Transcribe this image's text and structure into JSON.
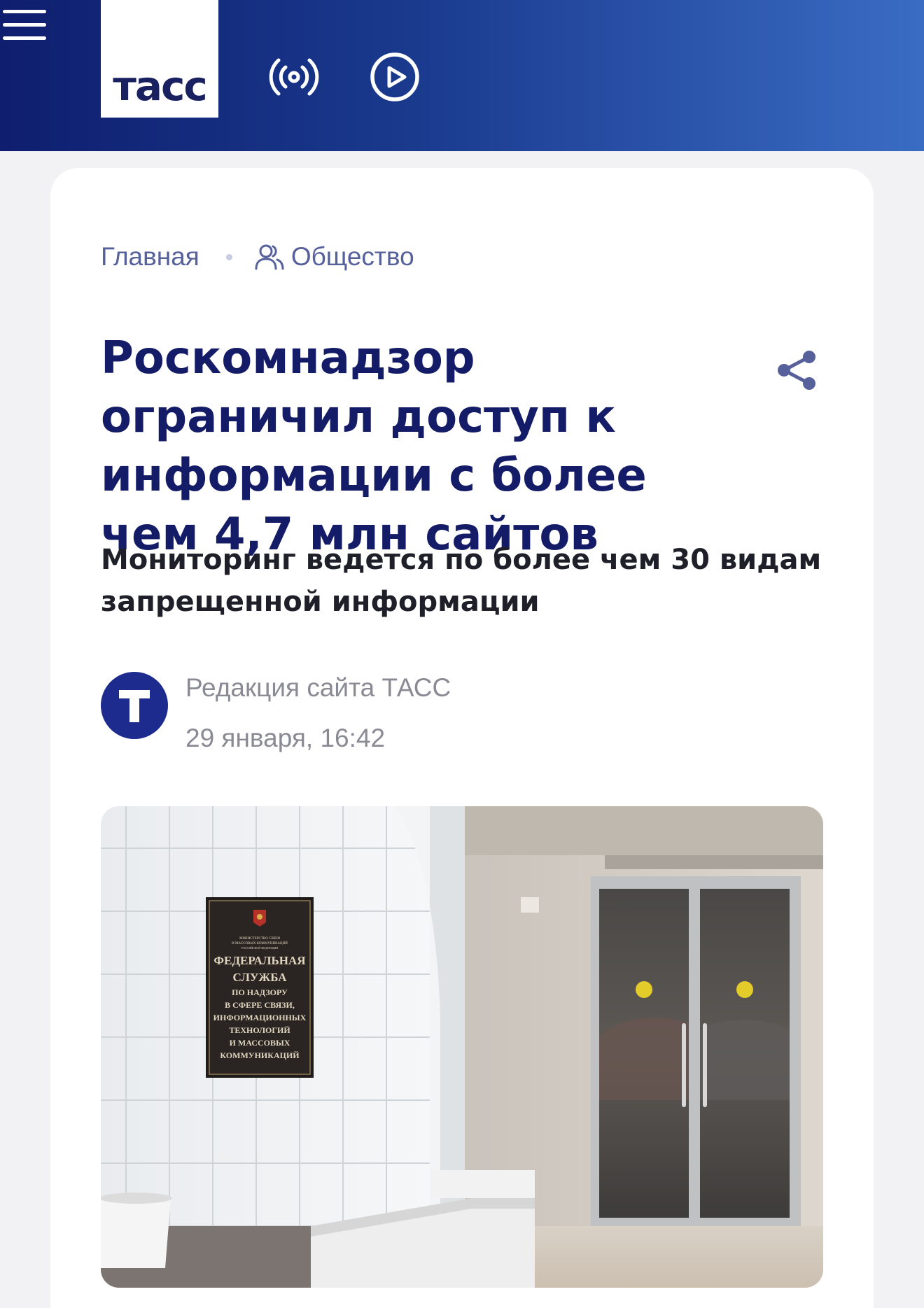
{
  "header": {
    "logo_text": "тасс"
  },
  "breadcrumb": {
    "home": "Главная",
    "section": "Общество"
  },
  "article": {
    "title": "Роскомнадзор ограничил доступ к информации с более чем 4,7 млн сайтов",
    "lead": "Мониторинг ведется по более чем 30 видам запрещенной информации",
    "author": "Редакция сайта ТАСС",
    "author_initial": "Т",
    "date": "29 января, 16:42"
  },
  "photo": {
    "plaque_lines": [
      "МИНИСТЕРСТВО СВЯЗИ",
      "И МАССОВЫХ КОММУНИКАЦИЙ",
      "РОССИЙСКОЙ ФЕДЕРАЦИИ",
      "ФЕДЕРАЛЬНАЯ",
      "СЛУЖБА",
      "ПО НАДЗОРУ",
      "В СФЕРЕ СВЯЗИ,",
      "ИНФОРМАЦИОННЫХ",
      "ТЕХНОЛОГИЙ",
      "И МАССОВЫХ",
      "КОММУНИКАЦИЙ"
    ]
  },
  "colors": {
    "header_dark": "#0f1e6e",
    "header_light": "#3a6cc4",
    "title": "#141c68",
    "breadcrumb": "#56609a",
    "meta": "#8a8a94",
    "avatar": "#1d2a8e"
  },
  "icons": {
    "radio": "radio-broadcast-icon",
    "play": "play-circle-icon",
    "menu": "hamburger-menu-icon",
    "section": "people-icon",
    "share": "share-icon"
  }
}
